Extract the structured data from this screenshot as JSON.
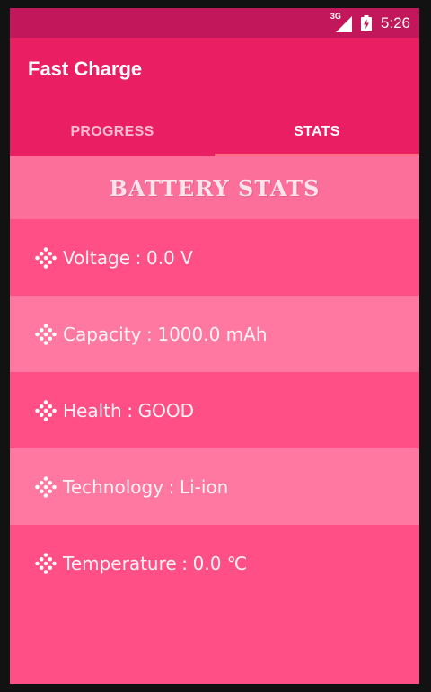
{
  "status_bar": {
    "network_label": "3G",
    "time": "5:26",
    "icons": [
      "signal-icon",
      "battery-charging-icon"
    ]
  },
  "app_bar": {
    "title": "Fast Charge"
  },
  "tabs": [
    {
      "label": "PROGRESS",
      "selected": false
    },
    {
      "label": "STATS",
      "selected": true
    }
  ],
  "stats": {
    "header": "BATTERY STATS",
    "separator": ":",
    "items": [
      {
        "label": "Voltage",
        "value": "0.0 V"
      },
      {
        "label": "Capacity",
        "value": "1000.0 mAh"
      },
      {
        "label": "Health",
        "value": "GOOD"
      },
      {
        "label": "Technology",
        "value": "Li-ion"
      },
      {
        "label": "Temperature",
        "value": "0.0 ℃"
      }
    ]
  },
  "colors": {
    "status_bar": "#c2185b",
    "app_bar": "#e91e63",
    "row_dark": "#ff4f86",
    "row_light": "#ff78a2",
    "tab_indicator": "#ff6f7f"
  }
}
